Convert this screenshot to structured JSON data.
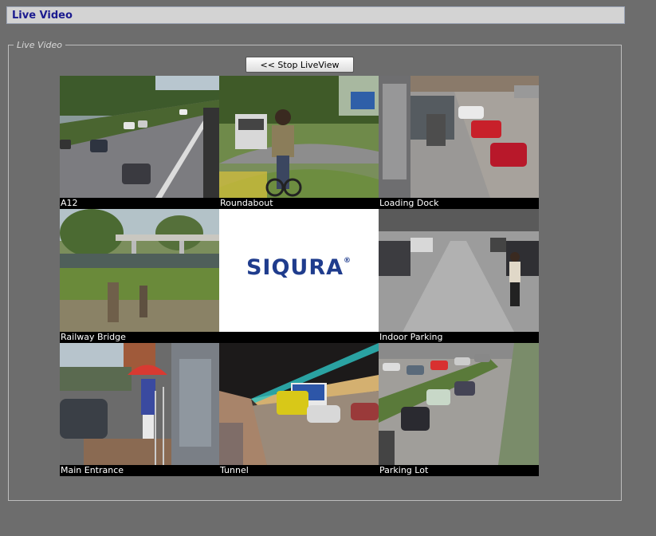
{
  "header": {
    "title": "Live Video"
  },
  "panel": {
    "legend": "Live Video"
  },
  "controls": {
    "stop_label": "<< Stop LiveView"
  },
  "logo": {
    "text": "SIQURA",
    "mark": "®"
  },
  "cameras": [
    {
      "label": "A12"
    },
    {
      "label": "Roundabout"
    },
    {
      "label": "Loading Dock"
    },
    {
      "label": "Railway Bridge"
    },
    {
      "label": "Indoor Parking"
    },
    {
      "label": "Main Entrance"
    },
    {
      "label": "Tunnel"
    },
    {
      "label": "Parking Lot"
    }
  ]
}
